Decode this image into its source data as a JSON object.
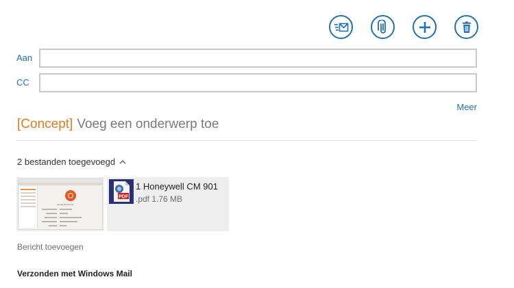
{
  "colors": {
    "accent": "#1e6fb5",
    "draft": "#e07b1f",
    "placeholder": "#7a7a7a",
    "tile_background": "#eeeeee"
  },
  "toolbar": {
    "send_icon": "send-mail-icon",
    "attach_icon": "paperclip-icon",
    "add_icon": "plus-icon",
    "delete_icon": "trash-icon"
  },
  "recipients": {
    "to_label": "Aan",
    "to_value": "",
    "cc_label": "CC",
    "cc_value": ""
  },
  "more_link": "Meer",
  "subject": {
    "draft_tag": "[Concept]",
    "placeholder": "Voeg een onderwerp toe"
  },
  "attachments": {
    "header": "2 bestanden toegevoegd",
    "header_icon": "chevron-up-icon",
    "items": [
      {
        "kind": "image-thumbnail",
        "thumbnail_caption": "ubuntu 16.04 LTS"
      },
      {
        "kind": "pdf",
        "icon": "pdf-file-icon",
        "name": "1 Honeywell CM 901",
        "meta": ".pdf 1.76 MB"
      }
    ]
  },
  "message": {
    "body_placeholder": "Bericht toevoegen",
    "signature": "Verzonden met Windows Mail"
  }
}
